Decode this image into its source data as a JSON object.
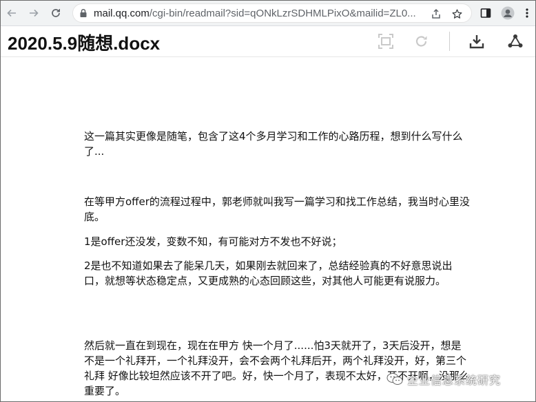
{
  "browser": {
    "url_host": "mail.qq.com",
    "url_path": "/cgi-bin/readmail?sid=qONkLzrSDHMLPixO&mailid=ZL0..."
  },
  "viewer": {
    "title": "2020.5.9随想.docx"
  },
  "document": {
    "paragraphs": [
      "这一篇其实更像是随笔，包含了这4个多月学习和工作的心路历程，想到什么写什么了...",
      "在等甲方offer的流程过程中，郭老师就叫我写一篇学习和找工作总结，我当时心里没底。",
      "1是offer还没发，变数不知，有可能对方不发也不好说；",
      "2是也不知道如果去了能呆几天，如果刚去就回来了，总结经验真的不好意思说出口，就想等状态稳定点，又更成熟的心态回顾这些，对其他人可能更有说服力。",
      "然后就一直在到现在，现在在甲方 快一个月了......怕3天就开了，3天后没开，想是不是一个礼拜开，一个礼拜没开，会不会两个礼拜后开，两个礼拜没开，好，第三个礼拜 好像比较坦然应该不开了吧。好，快一个月了，表现不太好，开不开啊，没那么重要了。"
    ]
  },
  "watermark": {
    "text": "企业信息系统研究"
  }
}
